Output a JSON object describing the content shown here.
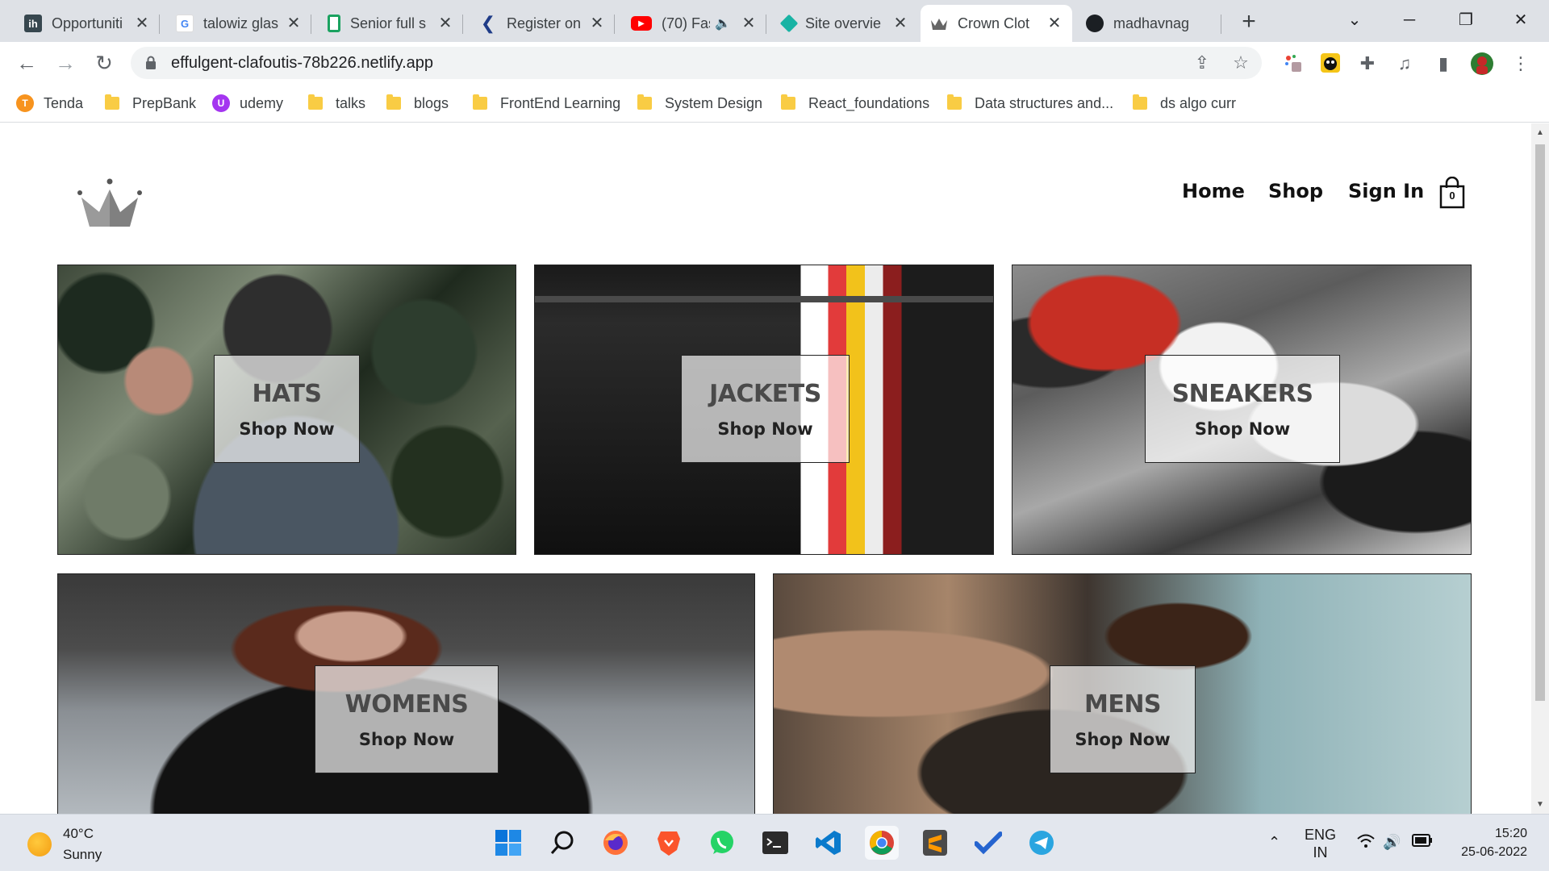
{
  "browser": {
    "tabs": [
      {
        "title": "Opportuniti",
        "icon": "interviewbit-icon",
        "fav_text": "ih",
        "color": "#37474f"
      },
      {
        "title": "talowiz glas",
        "icon": "google-icon",
        "fav_text": "G",
        "color": "#4285f4"
      },
      {
        "title": "Senior full s",
        "icon": "document-icon",
        "fav_text": "",
        "color": "#1aa260"
      },
      {
        "title": "Register on",
        "icon": "k-icon",
        "fav_text": "",
        "color": "#1f3c88"
      },
      {
        "title": "(70) Fas",
        "icon": "youtube-icon",
        "fav_text": "▶",
        "color": "#ff0000"
      },
      {
        "title": "Site overvie",
        "icon": "netlify-icon",
        "fav_text": "",
        "color": "#18b3a4"
      },
      {
        "title": "Crown Clot",
        "icon": "crown-icon",
        "fav_text": "",
        "color": "#666666"
      },
      {
        "title": "madhavnag",
        "icon": "github-icon",
        "fav_text": "",
        "color": "#1b1f23"
      }
    ],
    "url": "effulgent-clafoutis-78b226.netlify.app",
    "bookmarks": [
      {
        "label": "Tenda",
        "type": "app",
        "color": "#f7931e"
      },
      {
        "label": "PrepBank",
        "type": "folder"
      },
      {
        "label": "udemy",
        "type": "app",
        "color": "#a435f0"
      },
      {
        "label": "talks",
        "type": "folder"
      },
      {
        "label": "blogs",
        "type": "folder"
      },
      {
        "label": "FrontEnd Learning",
        "type": "folder"
      },
      {
        "label": "System Design",
        "type": "folder"
      },
      {
        "label": "React_foundations",
        "type": "folder"
      },
      {
        "label": "Data structures and...",
        "type": "folder"
      },
      {
        "label": "ds algo curr",
        "type": "folder"
      }
    ]
  },
  "site": {
    "nav": {
      "home": "Home",
      "shop": "Shop",
      "sign_in": "Sign In"
    },
    "cart_count": "0",
    "categories": [
      {
        "title": "HATS",
        "cta": "Shop Now"
      },
      {
        "title": "JACKETS",
        "cta": "Shop Now"
      },
      {
        "title": "SNEAKERS",
        "cta": "Shop Now"
      },
      {
        "title": "WOMENS",
        "cta": "Shop Now"
      },
      {
        "title": "MENS",
        "cta": "Shop Now"
      }
    ]
  },
  "taskbar": {
    "temperature": "40°C",
    "condition": "Sunny",
    "language": "ENG",
    "region": "IN",
    "time": "15:20",
    "date": "25-06-2022"
  }
}
